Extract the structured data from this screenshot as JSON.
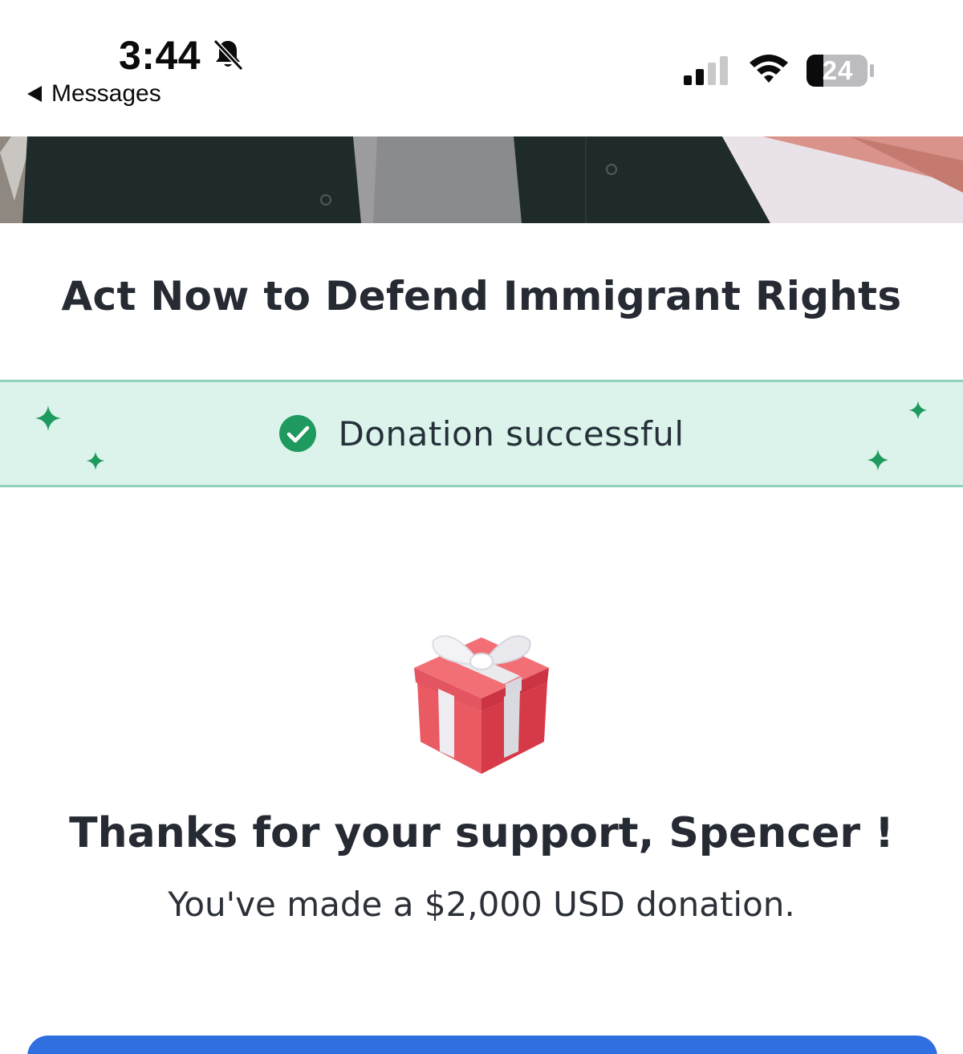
{
  "status_bar": {
    "time": "3:44",
    "back_label": "Messages",
    "battery_level": "24",
    "signal_bars_active": 2,
    "signal_bars_total": 4
  },
  "campaign": {
    "title": "Act Now to Defend Immigrant Rights"
  },
  "banner": {
    "message": "Donation successful",
    "accent_color": "#1f9a5f",
    "background_color": "#dcf3ec"
  },
  "confirmation": {
    "thanks_prefix": "Thanks for your support, ",
    "donor_name": "Spencer",
    "thanks_suffix": " !",
    "donation_message": "You've made a $2,000 USD donation."
  },
  "primary_button": {
    "color": "#2f6fe0"
  }
}
